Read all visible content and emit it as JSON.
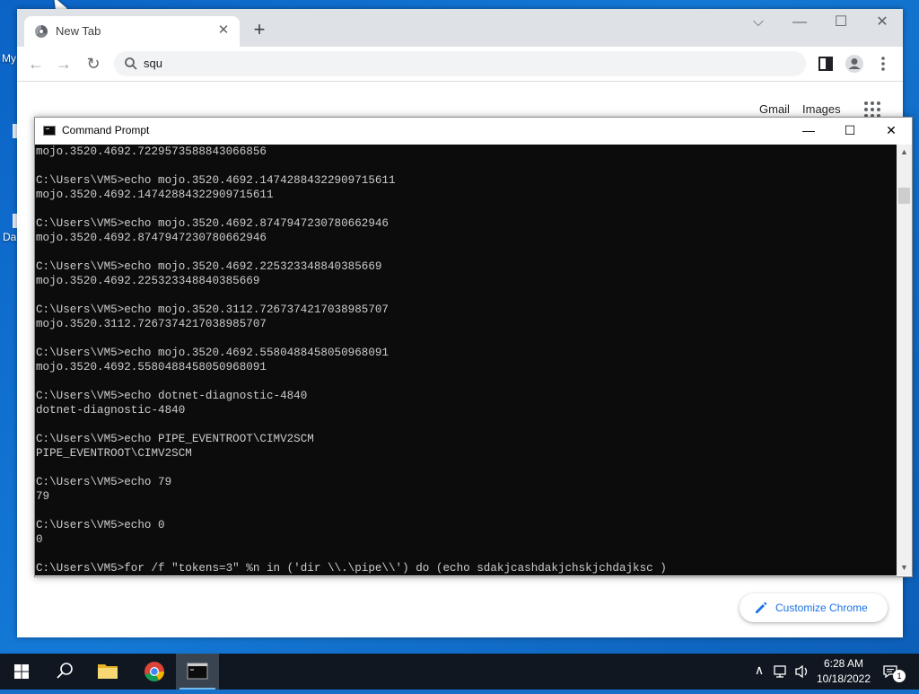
{
  "desktop": {
    "icon_labels": [
      "My",
      "Da"
    ]
  },
  "chrome": {
    "tab_title": "New Tab",
    "tab_close": "✕",
    "new_tab": "+",
    "window_controls": {
      "dropdown": "⌵",
      "minimize": "—",
      "maximize": "☐",
      "close": "✕"
    },
    "nav": {
      "back": "←",
      "forward": "→",
      "reload": "↻"
    },
    "omnibox_text": "squ",
    "ntp_links": {
      "gmail": "Gmail",
      "images": "Images"
    },
    "customize_label": "Customize Chrome",
    "colors": {
      "tabstrip": "#dee1e6",
      "accent": "#1a73e8"
    }
  },
  "cmd": {
    "title": "Command Prompt",
    "controls": {
      "minimize": "—",
      "maximize": "☐",
      "close": "✕"
    },
    "lines": [
      "mojo.3520.4692.7229573588843066856",
      "",
      "C:\\Users\\VM5>echo mojo.3520.4692.14742884322909715611",
      "mojo.3520.4692.14742884322909715611",
      "",
      "C:\\Users\\VM5>echo mojo.3520.4692.8747947230780662946",
      "mojo.3520.4692.8747947230780662946",
      "",
      "C:\\Users\\VM5>echo mojo.3520.4692.225323348840385669",
      "mojo.3520.4692.225323348840385669",
      "",
      "C:\\Users\\VM5>echo mojo.3520.3112.7267374217038985707",
      "mojo.3520.3112.7267374217038985707",
      "",
      "C:\\Users\\VM5>echo mojo.3520.4692.5580488458050968091",
      "mojo.3520.4692.5580488458050968091",
      "",
      "C:\\Users\\VM5>echo dotnet-diagnostic-4840",
      "dotnet-diagnostic-4840",
      "",
      "C:\\Users\\VM5>echo PIPE_EVENTROOT\\CIMV2SCM",
      "PIPE_EVENTROOT\\CIMV2SCM",
      "",
      "C:\\Users\\VM5>echo 79",
      "79",
      "",
      "C:\\Users\\VM5>echo 0",
      "0",
      "",
      "C:\\Users\\VM5>for /f \"tokens=3\" %n in ('dir \\\\.\\pipe\\\\') do (echo sdakjcashdakjchskjchdajksc )"
    ],
    "colors": {
      "background": "#0c0c0c",
      "text": "#cccccc"
    }
  },
  "taskbar": {
    "items": [
      "start-button",
      "search-button",
      "file-explorer",
      "chrome",
      "command-prompt"
    ],
    "time": "6:28 AM",
    "date": "10/18/2022",
    "tray": {
      "chevron": "∧",
      "speaker": "🔊"
    },
    "notification_count": "1"
  }
}
